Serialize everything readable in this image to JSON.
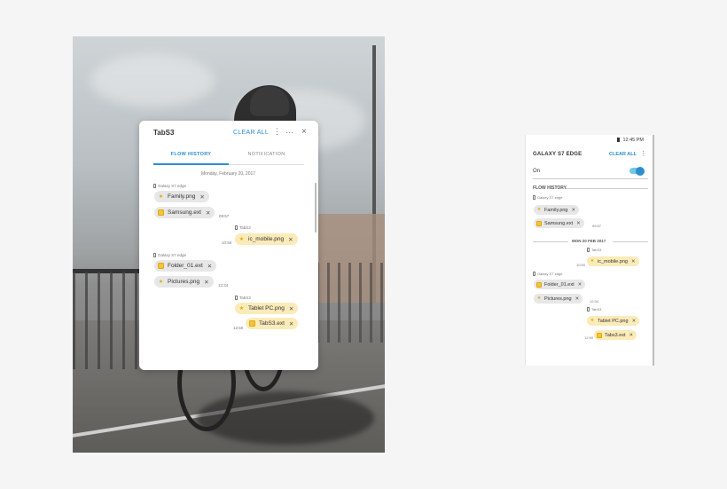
{
  "tablet": {
    "title": "TabS3",
    "clear_all": "CLEAR ALL",
    "icons": {
      "menu": "more-vertical-icon",
      "minimize": "minimize-icon",
      "close": "close-icon"
    },
    "tabs": [
      {
        "label": "FLOW HISTORY",
        "active": true
      },
      {
        "label": "NOTIFICATION",
        "active": false
      }
    ],
    "date": "Monday, February 20, 2017",
    "groups": [
      {
        "device": "Galaxy S7 edge",
        "side": "left",
        "time": "09:57",
        "items": [
          {
            "name": "Family.png",
            "icon": "star-icon"
          },
          {
            "name": "Samsung.ext",
            "icon": "folder-icon"
          }
        ]
      },
      {
        "device": "TabS3",
        "side": "right",
        "time": "10:50",
        "items": [
          {
            "name": "ic_mobile.png",
            "icon": "star-icon"
          }
        ]
      },
      {
        "device": "Galaxy S7 edge",
        "side": "left",
        "time": "12:34",
        "items": [
          {
            "name": "Folder_01.ext",
            "icon": "folder-icon"
          },
          {
            "name": "Pictures.png",
            "icon": "star-icon"
          }
        ]
      },
      {
        "device": "TabS3",
        "side": "right",
        "time": "12:50",
        "items": [
          {
            "name": "Tablet PC.png",
            "icon": "star-icon"
          },
          {
            "name": "TabS3.ext",
            "icon": "folder-icon"
          }
        ]
      }
    ]
  },
  "phone": {
    "status_time": "12:45 PM",
    "title": "GALAXY S7 EDGE",
    "clear_all": "CLEAR ALL",
    "on_label": "On",
    "toggle_on": true,
    "section": "FLOW HISTORY",
    "date": "MON 20 FEB 2017",
    "groups": [
      {
        "device": "Galaxy S7 edge",
        "side": "left",
        "time": "09:57",
        "items": [
          {
            "name": "Family.png",
            "icon": "star-icon"
          },
          {
            "name": "Samsung.ext",
            "icon": "folder-icon"
          }
        ]
      },
      {
        "device": "TabS3",
        "side": "right",
        "time": "10:50",
        "items": [
          {
            "name": "ic_mobile.png",
            "icon": "star-icon"
          }
        ]
      },
      {
        "device": "Galaxy S7 edge",
        "side": "left",
        "time": "12:34",
        "items": [
          {
            "name": "Folder_01.ext",
            "icon": "folder-icon"
          },
          {
            "name": "Pictures.png",
            "icon": "star-icon"
          }
        ]
      },
      {
        "device": "TabS3",
        "side": "right",
        "time": "12:50",
        "items": [
          {
            "name": "Tablet PC.png",
            "icon": "star-icon"
          },
          {
            "name": "Tabs3.ext",
            "icon": "folder-icon"
          }
        ]
      }
    ]
  },
  "colors": {
    "accent": "#2b8fce",
    "chip_received": "#fbebb9",
    "chip_sent": "#e7e7e7",
    "toggle_track": "#76c6e6"
  }
}
